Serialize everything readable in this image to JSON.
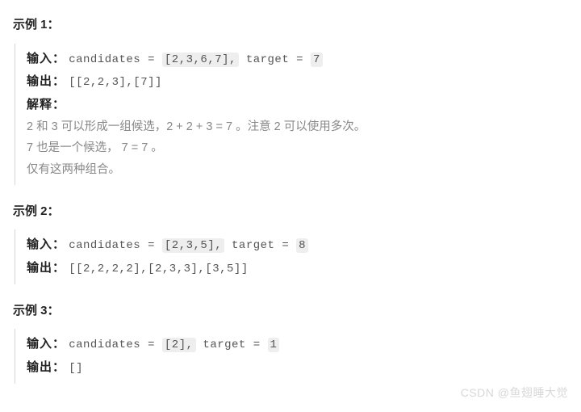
{
  "examples": [
    {
      "heading": "示例 1：",
      "input_label": "输入：",
      "input_prefix": "candidates = ",
      "input_hl": "[2,3,6,7],",
      "input_mid": " target = ",
      "input_hl2": "7",
      "output_label": "输出：",
      "output_value": "[[2,2,3],[7]]",
      "explain_label": "解释：",
      "explain_lines": [
        "2 和 3 可以形成一组候选，2 + 2 + 3 = 7 。注意 2 可以使用多次。",
        "7 也是一个候选， 7 = 7 。",
        "仅有这两种组合。"
      ]
    },
    {
      "heading": "示例 2：",
      "input_label": "输入：",
      "input_prefix": "candidates = ",
      "input_hl": "[2,3,5],",
      "input_mid": " target = ",
      "input_hl2": "8",
      "output_label": "输出：",
      "output_value": "[[2,2,2,2],[2,3,3],[3,5]]"
    },
    {
      "heading": "示例 3：",
      "input_label": "输入：",
      "input_prefix": "candidates = ",
      "input_hl": "[2],",
      "input_mid": " target = ",
      "input_hl2": "1",
      "output_label": "输出：",
      "output_value": "[]"
    }
  ],
  "watermark": "CSDN @鱼翅睡大觉"
}
